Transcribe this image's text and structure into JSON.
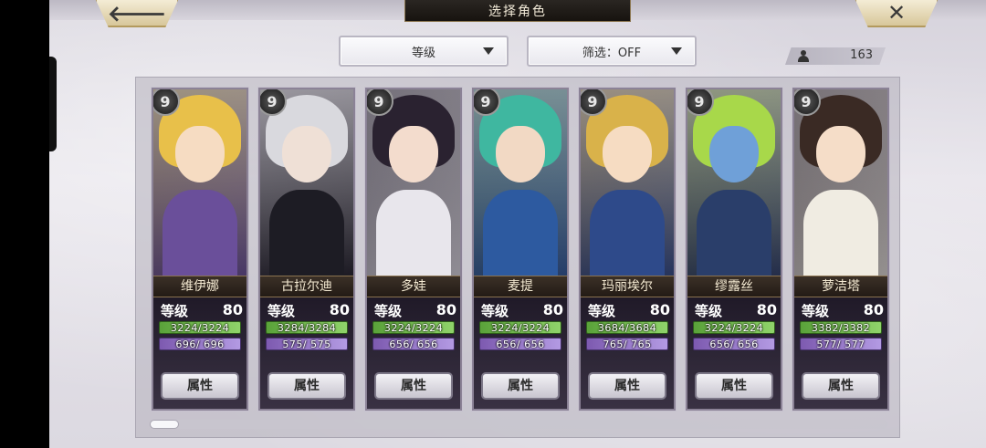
{
  "header": {
    "title": "选择角色",
    "back_label": "🡐",
    "close_label": "✕"
  },
  "filters": {
    "sort_label": "等级",
    "filter_label": "筛选：OFF"
  },
  "roster_count": "163",
  "cards": [
    {
      "key_level": "9",
      "name": "维伊娜",
      "level_label": "等级",
      "level": "80",
      "hp": "3224/3224",
      "mp": "696/ 696",
      "attr_label": "属性",
      "hair": "#e8c04a",
      "skin": "#f6dcc2",
      "outfit": "#6a4f9a"
    },
    {
      "key_level": "9",
      "name": "古拉尔迪",
      "level_label": "等级",
      "level": "80",
      "hp": "3284/3284",
      "mp": "575/ 575",
      "attr_label": "属性",
      "hair": "#d9d9de",
      "skin": "#efe0d6",
      "outfit": "#1d1c24"
    },
    {
      "key_level": "9",
      "name": "多娃",
      "level_label": "等级",
      "level": "80",
      "hp": "3224/3224",
      "mp": "656/ 656",
      "attr_label": "属性",
      "hair": "#2a2230",
      "skin": "#f3dccd",
      "outfit": "#e8e6ec"
    },
    {
      "key_level": "9",
      "name": "麦提",
      "level_label": "等级",
      "level": "80",
      "hp": "3224/3224",
      "mp": "656/ 656",
      "attr_label": "属性",
      "hair": "#3fb7a0",
      "skin": "#f2d9c4",
      "outfit": "#2d5aa0"
    },
    {
      "key_level": "9",
      "name": "玛丽埃尔",
      "level_label": "等级",
      "level": "80",
      "hp": "3684/3684",
      "mp": "765/ 765",
      "attr_label": "属性",
      "hair": "#d9b24a",
      "skin": "#f6dcc2",
      "outfit": "#2e4a8a"
    },
    {
      "key_level": "9",
      "name": "缪露丝",
      "level_label": "等级",
      "level": "80",
      "hp": "3224/3224",
      "mp": "656/ 656",
      "attr_label": "属性",
      "hair": "#a8d84a",
      "skin": "#6fa0d8",
      "outfit": "#2a3e6a"
    },
    {
      "key_level": "9",
      "name": "萝洁塔",
      "level_label": "等级",
      "level": "80",
      "hp": "3382/3382",
      "mp": "577/ 577",
      "attr_label": "属性",
      "hair": "#3a2a24",
      "skin": "#f5ddc8",
      "outfit": "#f0ece2"
    }
  ]
}
